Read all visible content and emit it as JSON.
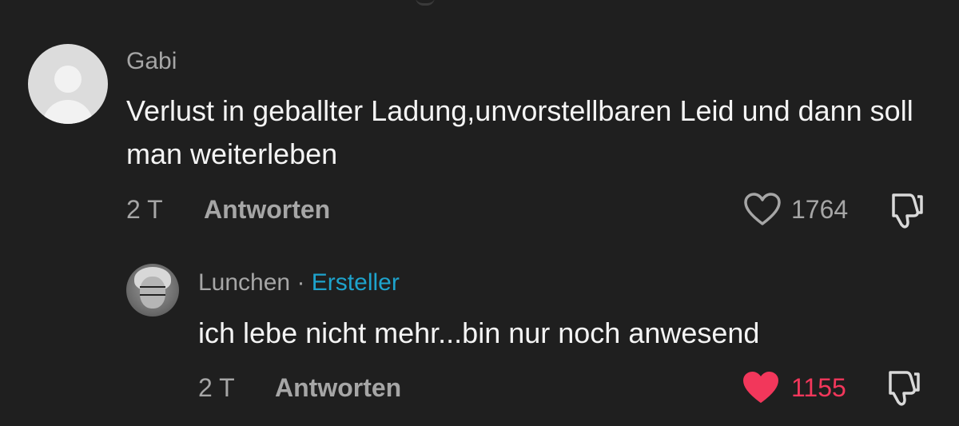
{
  "comments": [
    {
      "username": "Gabi",
      "text": "Verlust in geballter Ladung,unvorstellbaren Leid und dann soll man weiterleben",
      "time": "2 T",
      "reply_label": "Antworten",
      "likes": "1764",
      "liked": false,
      "avatar": "default-avatar-icon"
    },
    {
      "username": "Lunchen",
      "separator": "·",
      "badge": "Ersteller",
      "text": "ich lebe nicht mehr...bin nur noch anwesend",
      "time": "2 T",
      "reply_label": "Antworten",
      "likes": "1155",
      "liked": true,
      "avatar": "user-photo-avatar"
    }
  ],
  "colors": {
    "background": "#1f1f1f",
    "username": "#a6a6a6",
    "creator_badge": "#1ea3cc",
    "liked_heart": "#f2375b"
  }
}
